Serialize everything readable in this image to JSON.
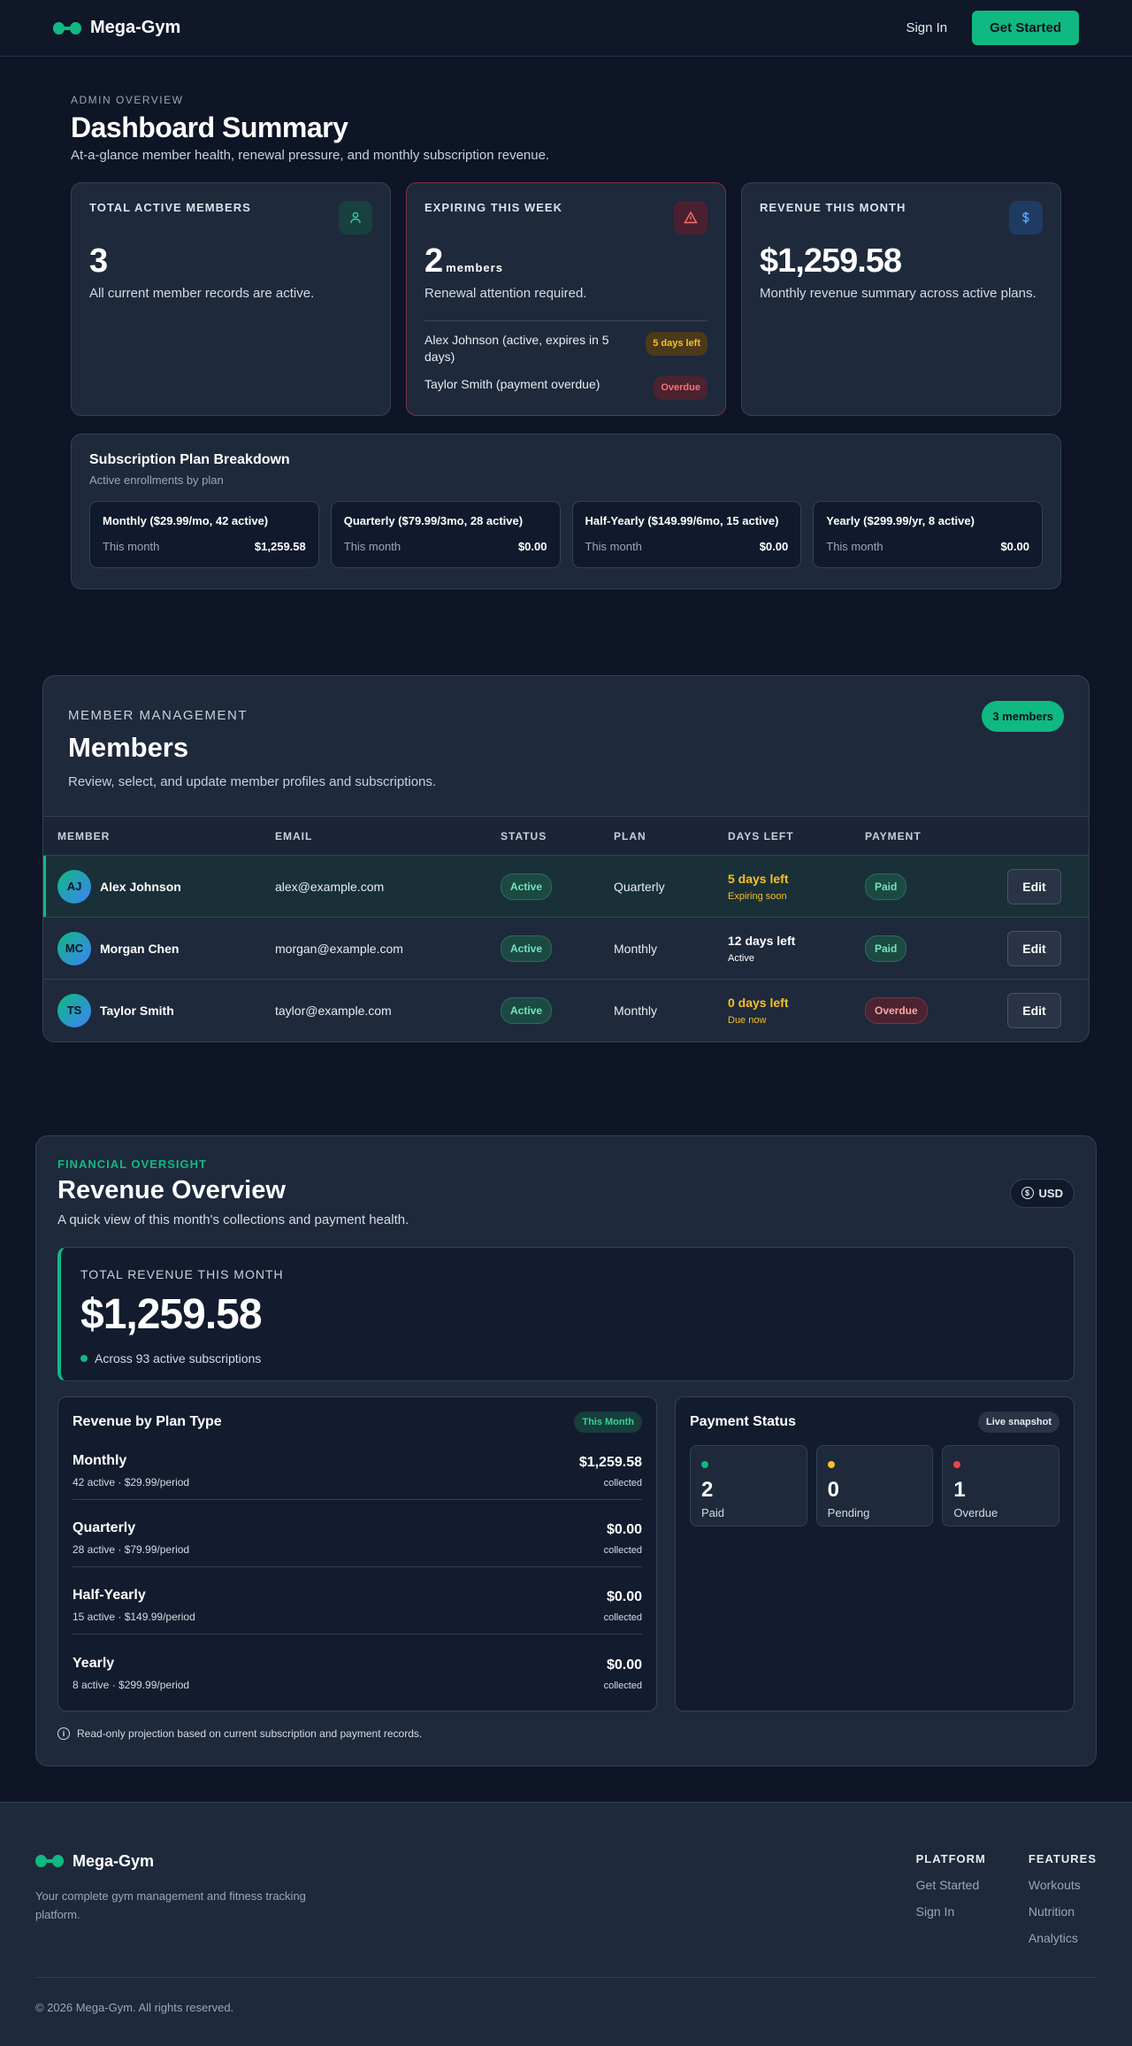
{
  "header": {
    "brand": "Mega-Gym",
    "sign_in": "Sign In",
    "get_started": "Get Started"
  },
  "dashboard": {
    "eyebrow": "ADMIN OVERVIEW",
    "title": "Dashboard Summary",
    "subtitle": "At-a-glance member health, renewal pressure, and monthly subscription revenue.",
    "cards": {
      "active": {
        "label": "TOTAL ACTIVE MEMBERS",
        "value": "3",
        "desc": "All current member records are active."
      },
      "expiring": {
        "label": "EXPIRING THIS WEEK",
        "value": "2",
        "unit": "members",
        "desc": "Renewal attention required.",
        "items": [
          {
            "text": "Alex Johnson (active, expires in 5 days)",
            "badge": "5 days left"
          },
          {
            "text": "Taylor Smith (payment overdue)",
            "badge": "Overdue"
          }
        ]
      },
      "revenue": {
        "label": "REVENUE THIS MONTH",
        "value": "$1,259.58",
        "desc": "Monthly revenue summary across active plans."
      }
    },
    "plans": {
      "title": "Subscription Plan Breakdown",
      "subtitle": "Active enrollments by plan",
      "items": [
        {
          "name": "Monthly ($29.99/mo, 42 active)",
          "label": "This month",
          "amount": "$1,259.58"
        },
        {
          "name": "Quarterly ($79.99/3mo, 28 active)",
          "label": "This month",
          "amount": "$0.00"
        },
        {
          "name": "Half-Yearly ($149.99/6mo, 15 active)",
          "label": "This month",
          "amount": "$0.00"
        },
        {
          "name": "Yearly ($299.99/yr, 8 active)",
          "label": "This month",
          "amount": "$0.00"
        }
      ]
    }
  },
  "members": {
    "eyebrow": "MEMBER MANAGEMENT",
    "title": "Members",
    "subtitle": "Review, select, and update member profiles and subscriptions.",
    "count": "3 members",
    "columns": [
      "MEMBER",
      "EMAIL",
      "STATUS",
      "PLAN",
      "DAYS LEFT",
      "PAYMENT"
    ],
    "rows": [
      {
        "initials": "AJ",
        "name": "Alex Johnson",
        "email": "alex@example.com",
        "status": "Active",
        "plan": "Quarterly",
        "days": "5 days left",
        "days_sub": "Expiring soon",
        "payment": "Paid",
        "edit": "Edit"
      },
      {
        "initials": "MC",
        "name": "Morgan Chen",
        "email": "morgan@example.com",
        "status": "Active",
        "plan": "Monthly",
        "days": "12 days left",
        "days_sub": "Active",
        "payment": "Paid",
        "edit": "Edit"
      },
      {
        "initials": "TS",
        "name": "Taylor Smith",
        "email": "taylor@example.com",
        "status": "Active",
        "plan": "Monthly",
        "days": "0 days left",
        "days_sub": "Due now",
        "payment": "Overdue",
        "edit": "Edit"
      }
    ]
  },
  "revenue": {
    "eyebrow": "FINANCIAL OVERSIGHT",
    "title": "Revenue Overview",
    "subtitle": "A quick view of this month's collections and payment health.",
    "currency": "USD",
    "total_label": "TOTAL REVENUE THIS MONTH",
    "total_value": "$1,259.58",
    "total_note": "Across 93 active subscriptions",
    "plans_title": "Revenue by Plan Type",
    "plans_tag": "This Month",
    "plans": [
      {
        "name": "Monthly",
        "meta": "42 active · $29.99/period",
        "amount": "$1,259.58",
        "note": "collected"
      },
      {
        "name": "Quarterly",
        "meta": "28 active · $79.99/period",
        "amount": "$0.00",
        "note": "collected"
      },
      {
        "name": "Half-Yearly",
        "meta": "15 active · $149.99/period",
        "amount": "$0.00",
        "note": "collected"
      },
      {
        "name": "Yearly",
        "meta": "8 active · $299.99/period",
        "amount": "$0.00",
        "note": "collected"
      }
    ],
    "status_title": "Payment Status",
    "status_tag": "Live snapshot",
    "status": [
      {
        "count": "2",
        "label": "Paid"
      },
      {
        "count": "0",
        "label": "Pending"
      },
      {
        "count": "1",
        "label": "Overdue"
      }
    ],
    "note": "Read-only projection based on current subscription and payment records."
  },
  "footer": {
    "brand": "Mega-Gym",
    "desc": "Your complete gym management and fitness tracking platform.",
    "platform": {
      "title": "PLATFORM",
      "links": [
        "Get Started",
        "Sign In"
      ]
    },
    "features": {
      "title": "FEATURES",
      "links": [
        "Workouts",
        "Nutrition",
        "Analytics"
      ]
    },
    "copyright": "© 2026 Mega-Gym. All rights reserved."
  }
}
